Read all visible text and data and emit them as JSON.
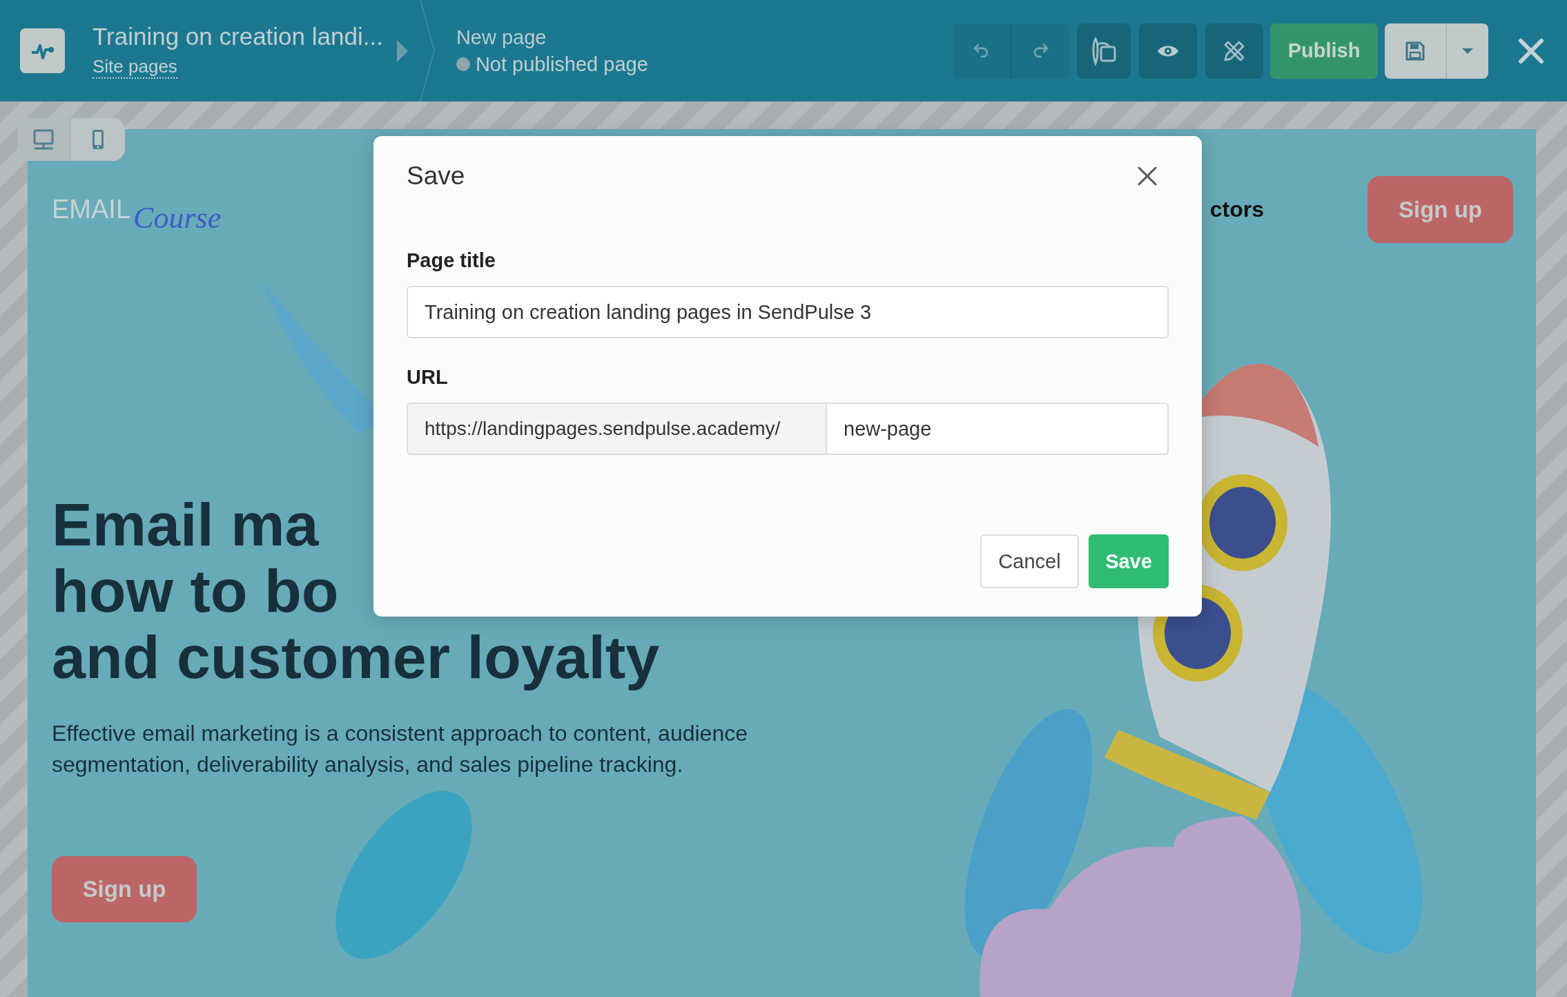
{
  "header": {
    "title": "Training on creation landi...",
    "breadcrumb_link": "Site pages",
    "page_name": "New page",
    "status": "Not published page",
    "published": false
  },
  "toolbar": {
    "publish": "Publish"
  },
  "device_toggle": [
    {
      "kind": "desktop",
      "selected": true
    },
    {
      "kind": "mobile",
      "selected": false
    }
  ],
  "landing": {
    "logo_word": "EMAIL",
    "logo_script": "Course",
    "nav_link": "ctors",
    "header_button": "Sign up",
    "heading_lines": [
      "Email ma",
      "how to bo",
      "and customer loyalty"
    ],
    "paragraph": "Effective email marketing is a consistent approach to content, audience segmentation, deliverability analysis, and sales pipeline tracking.",
    "cta_button": "Sign up"
  },
  "dialog": {
    "title": "Save",
    "fields": [
      {
        "kind": "text",
        "label": "Page title",
        "value": "Training on creation landing pages in SendPulse 3"
      },
      {
        "kind": "url",
        "label": "URL",
        "prefix": "https://landingpages.sendpulse.academy/",
        "value": "new-page"
      }
    ],
    "buttons": [
      {
        "kind": "secondary",
        "label": "Cancel"
      },
      {
        "kind": "primary",
        "label": "Save"
      }
    ]
  }
}
